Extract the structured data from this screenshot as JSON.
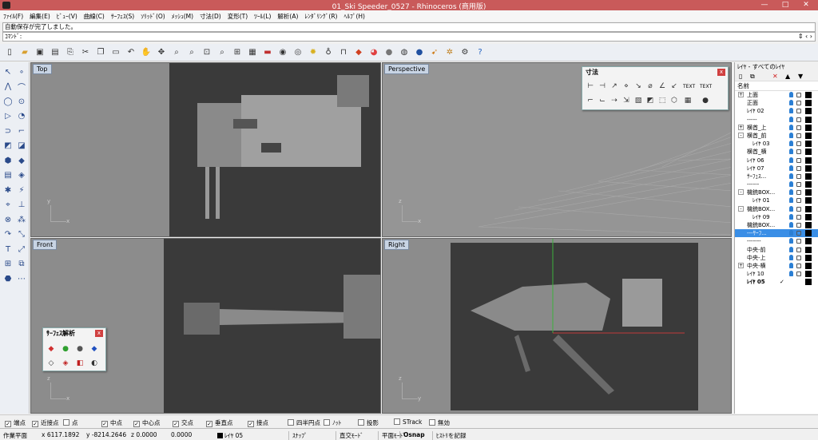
{
  "window": {
    "title": "01_Ski Speeder_0527 - Rhinoceros (商用版)",
    "buttons": [
      "—",
      "□",
      "✕"
    ]
  },
  "menu": [
    "ﾌｧｲﾙ(F)",
    "編集(E)",
    "ﾋﾞｭｰ(V)",
    "曲線(C)",
    "ｻｰﾌｪｽ(S)",
    "ｿﾘｯﾄﾞ(O)",
    "ﾒｯｼｭ(M)",
    "寸法(D)",
    "変形(T)",
    "ﾂｰﾙ(L)",
    "解析(A)",
    "ﾚﾝﾀﾞﾘﾝｸﾞ(R)",
    "ﾍﾙﾌﾟ(H)"
  ],
  "command": {
    "history": "自動保存が完了しました。",
    "prompt": "ｺﾏﾝﾄﾞ:",
    "arrows": "⇕ ‹ ›"
  },
  "toolbar_icons": [
    "new-file-icon",
    "open-folder-icon",
    "save-icon",
    "print-icon",
    "import-icon",
    "cut-icon",
    "copy-icon",
    "paste-icon",
    "undo-icon",
    "pan-hand-icon",
    "rotate-view-icon",
    "zoom-icon",
    "zoom-window-icon",
    "zoom-extents-icon",
    "zoom-selected-icon",
    "four-viewports-icon",
    "grid-icon",
    "car-icon",
    "eye-icon",
    "camera-icon",
    "light-bulb-icon",
    "bulb-icon",
    "lock-icon",
    "layer-icon",
    "color-wheel-icon",
    "sphere-icon",
    "render-icon",
    "globe-icon",
    "pointer-icon",
    "gear-icon",
    "options-icon",
    "help-icon"
  ],
  "viewports": {
    "top": "Top",
    "perspective": "Perspective",
    "front": "Front",
    "right": "Right"
  },
  "axis_labels": {
    "x": "x",
    "y": "y",
    "z": "z"
  },
  "dimension_panel": {
    "title": "寸法",
    "close": "x",
    "text1": "TEXT",
    "text2": "TEXT"
  },
  "surface_panel": {
    "title": "ｻｰﾌｪｽ解析",
    "close": "x"
  },
  "layers": {
    "header": "ﾚｲﾔ - すべてのﾚｲﾔ",
    "column": "名前",
    "rows": [
      {
        "name": "上面",
        "expander": "+",
        "indent": 1
      },
      {
        "name": "正面",
        "indent": 1
      },
      {
        "name": "ﾚｲﾔ 02",
        "indent": 1
      },
      {
        "name": "-----",
        "indent": 1
      },
      {
        "name": "横首_上",
        "expander": "+",
        "indent": 1
      },
      {
        "name": "横首_前",
        "expander": "-",
        "indent": 1
      },
      {
        "name": "ﾚｲﾔ 03",
        "indent": 2
      },
      {
        "name": "横首_横",
        "indent": 1
      },
      {
        "name": "ﾚｲﾔ 06",
        "indent": 1
      },
      {
        "name": "ﾚｲﾔ 07",
        "indent": 1
      },
      {
        "name": "ｻｰﾌｪｽ...",
        "indent": 1
      },
      {
        "name": "------",
        "indent": 1
      },
      {
        "name": "機銃BOX...",
        "expander": "-",
        "indent": 1
      },
      {
        "name": "ﾚｲﾔ 01",
        "indent": 2
      },
      {
        "name": "機銃BOX...",
        "expander": "-",
        "indent": 1
      },
      {
        "name": "ﾚｲﾔ 09",
        "indent": 2
      },
      {
        "name": "機銃BOX...",
        "indent": 1
      },
      {
        "name": "---ｻｰﾌ...",
        "indent": 1,
        "selected": true
      },
      {
        "name": "-------",
        "indent": 1
      },
      {
        "name": "中央-前",
        "indent": 1
      },
      {
        "name": "中央-上",
        "indent": 1
      },
      {
        "name": "中央-横",
        "expander": "+",
        "indent": 1
      },
      {
        "name": "ﾚｲﾔ 10",
        "indent": 1
      },
      {
        "name": "ﾚｲﾔ 05",
        "indent": 1,
        "current": true,
        "check": "✓"
      }
    ]
  },
  "osnap": [
    {
      "label": "端点",
      "checked": true
    },
    {
      "label": "近接点",
      "checked": true
    },
    {
      "label": "点",
      "checked": false
    },
    {
      "label": "中点",
      "checked": true
    },
    {
      "label": "中心点",
      "checked": true
    },
    {
      "label": "交点",
      "checked": true
    },
    {
      "label": "垂直点",
      "checked": true
    },
    {
      "label": "接点",
      "checked": true
    },
    {
      "label": "四半円点",
      "checked": false
    },
    {
      "label": "ﾉｯﾄ",
      "checked": false
    },
    {
      "label": "投影",
      "checked": false
    },
    {
      "label": "STrack",
      "checked": false
    },
    {
      "label": "無効",
      "checked": false
    }
  ],
  "status": {
    "plane": "作業平面",
    "x": "x 6117.1892",
    "y": "y -8214.2646",
    "z": "z 0.0000",
    "dist": "0.0000",
    "layer": "ﾚｲﾔ 05",
    "snap": "ｽﾅｯﾌﾟ",
    "ortho": "直交ﾓｰﾄﾞ",
    "planar": "平面ﾓｰﾄﾞ",
    "osnap": "Osnap",
    "history": "ﾋｽﾄﾘを記録"
  },
  "colors": {
    "titlebar": "#c95a5a",
    "selection": "#3a8ee6",
    "viewport_bg": "#8c8c8c"
  }
}
